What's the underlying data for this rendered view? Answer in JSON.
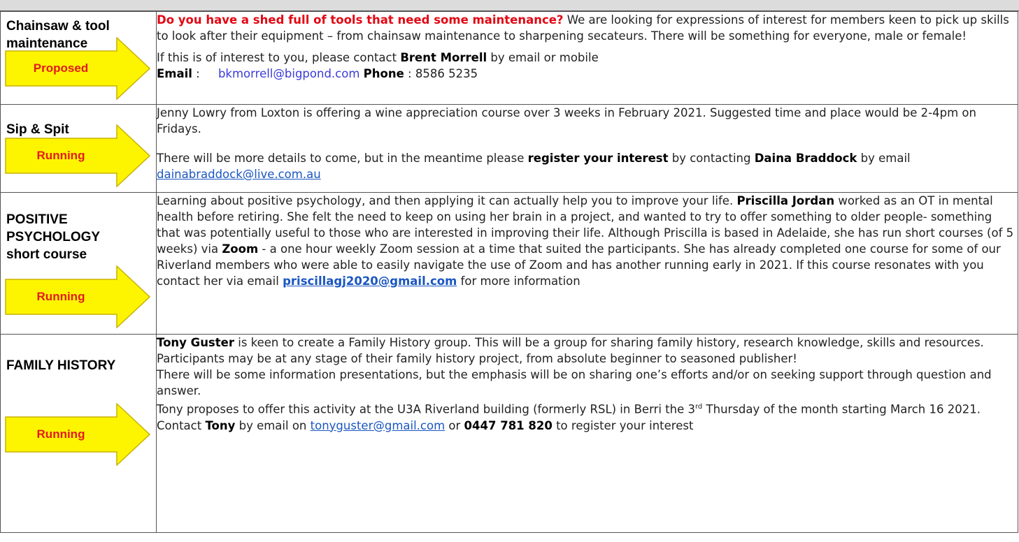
{
  "colors": {
    "arrow_fill": "#fdf500",
    "arrow_stroke": "#c9b100",
    "status_text": "#e31b1b",
    "heading_red": "#e30613",
    "link_blue": "#1a56c2"
  },
  "rows": [
    {
      "title_line1": "Chainsaw & tool",
      "title_line2": "maintenance",
      "status": "Proposed",
      "lead_question": "Do you have a shed full of tools that need some maintenance?",
      "p1_rest": " We are looking for expressions of interest for members keen to pick up skills to look after their equipment – from chainsaw maintenance to sharpening secateurs. There will be something for everyone, male or female!",
      "p2_pre": "If this is of interest to you, please contact ",
      "p2_name": "Brent Morrell",
      "p2_post": " by email or mobile",
      "email_label": "Email",
      "email_sep": " :     ",
      "email": "bkmorrell@bigpond.com",
      "phone_label": "Phone",
      "phone_sep": " : ",
      "phone": "8586 5235"
    },
    {
      "title": "Sip & Spit",
      "status": "Running",
      "p1": "Jenny Lowry from Loxton is offering a wine appreciation course over 3 weeks in February 2021. Suggested time and place would be 2-4pm on Fridays.",
      "p2_pre": "There will be more details to come, but in the meantime please ",
      "p2_bold": "register your interest",
      "p2_mid": " by contacting ",
      "p2_name": "Daina Braddock",
      "p2_post": " by email ",
      "email": " dainabraddock@live.com.au"
    },
    {
      "title_line1": "POSITIVE",
      "title_line2": "PSYCHOLOGY",
      "title_line3": "short course",
      "status": "Running",
      "t1": "Learning about positive psychology, and then applying it can actually help you to improve your life. ",
      "name": "Priscilla Jordan",
      "t2": " worked as an OT in mental health before retiring. She felt the need to keep on using her brain in a project, and wanted to try to offer something to older people- something that was potentially useful to those who are interested in improving their life. Although Priscilla is based in Adelaide, she has run short courses (of 5 weeks) via ",
      "zoom": "Zoom",
      "t3": " - a one hour weekly Zoom session at a time that suited the participants. She has already completed one course for some of our Riverland members who were able to easily navigate the use of Zoom and has another running early in 2021. If this course resonates with you contact her via email ",
      "email": "priscillagj2020@gmail.com",
      "t4": " for more information"
    },
    {
      "title": "FAMILY HISTORY",
      "status": "Running",
      "name": "Tony Guster",
      "t1": " is keen to create a Family History group. This will be a group for sharing family history, research knowledge, skills and resources. Participants may be at any stage of their family history project, from absolute beginner to seasoned publisher!",
      "t2": "There will be some information presentations, but the emphasis will be on sharing one’s efforts and/or on seeking support through question and answer.",
      "t3_pre": "Tony proposes to offer this activity at the U3A Riverland building (formerly RSL) in Berri the 3",
      "t3_sup": "rd",
      "t3_post": " Thursday of the month starting March 16 2021. Contact ",
      "contact": "Tony",
      "t3_mid": " by email on ",
      "email": "tonyguster@gmail.com",
      "t3_or": " or ",
      "phone": "0447 781 820",
      "t3_end": " to register your interest"
    }
  ]
}
